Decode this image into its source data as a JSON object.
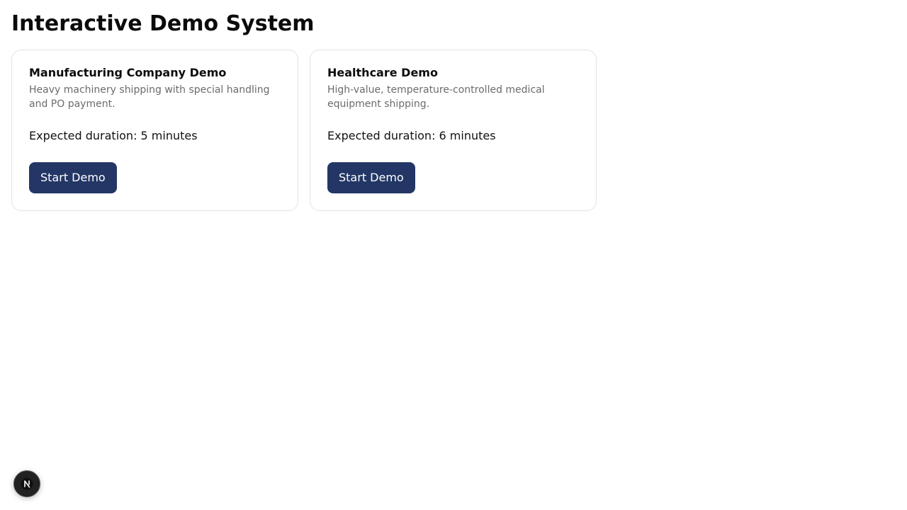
{
  "page": {
    "title": "Interactive Demo System"
  },
  "demos": [
    {
      "title": "Manufacturing Company Demo",
      "description": "Heavy machinery shipping with special handling and PO payment.",
      "duration": "Expected duration: 5 minutes",
      "button_label": "Start Demo"
    },
    {
      "title": "Healthcare Demo",
      "description": "High-value, temperature-controlled medical equipment shipping.",
      "duration": "Expected duration: 6 minutes",
      "button_label": "Start Demo"
    }
  ],
  "colors": {
    "button_bg": "#233665",
    "button_text": "#ffffff",
    "card_border": "#e3e3e3",
    "description_text": "#6b6b6b"
  },
  "dev_badge": {
    "icon": "nextjs-logo-icon"
  }
}
